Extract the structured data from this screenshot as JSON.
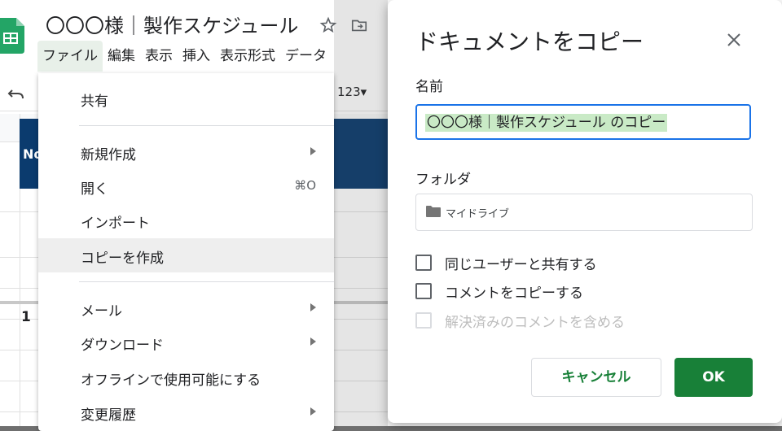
{
  "document": {
    "title": "〇〇〇様｜製作スケジュール",
    "star_icon": "star-icon",
    "move_icon": "move-to-folder-icon"
  },
  "menubar": {
    "items": [
      "ファイル",
      "編集",
      "表示",
      "挿入",
      "表示形式",
      "データ"
    ],
    "active": "ファイル"
  },
  "toolbar": {
    "undo_icon": "undo-icon",
    "number_format": "123▾"
  },
  "sheet": {
    "header_cell_text": "No",
    "first_row_value": "1",
    "header_color": "#0b3b6e"
  },
  "file_menu": {
    "items": [
      {
        "label": "共有",
        "shortcut": "",
        "submenu": false
      },
      {
        "label": "新規作成",
        "shortcut": "",
        "submenu": true
      },
      {
        "label": "開く",
        "shortcut": "⌘O",
        "submenu": false
      },
      {
        "label": "インポート",
        "shortcut": "",
        "submenu": false
      },
      {
        "label": "コピーを作成",
        "shortcut": "",
        "submenu": false,
        "highlighted": true
      },
      {
        "label": "メール",
        "shortcut": "",
        "submenu": true
      },
      {
        "label": "ダウンロード",
        "shortcut": "",
        "submenu": true
      },
      {
        "label": "オフラインで使用可能にする",
        "shortcut": "",
        "submenu": false
      },
      {
        "label": "変更履歴",
        "shortcut": "",
        "submenu": true
      }
    ]
  },
  "dialog": {
    "title": "ドキュメントをコピー",
    "close_icon": "close-icon",
    "name_label": "名前",
    "name_value": "〇〇〇様｜製作スケジュール のコピー",
    "folder_label": "フォルダ",
    "folder_value": "マイドライブ",
    "checkboxes": [
      {
        "label": "同じユーザーと共有する",
        "checked": false,
        "disabled": false
      },
      {
        "label": "コメントをコピーする",
        "checked": false,
        "disabled": false
      },
      {
        "label": "解決済みのコメントを含める",
        "checked": false,
        "disabled": true
      }
    ],
    "cancel_label": "キャンセル",
    "ok_label": "OK",
    "accent_color": "#188038",
    "focus_color": "#1a73e8"
  }
}
